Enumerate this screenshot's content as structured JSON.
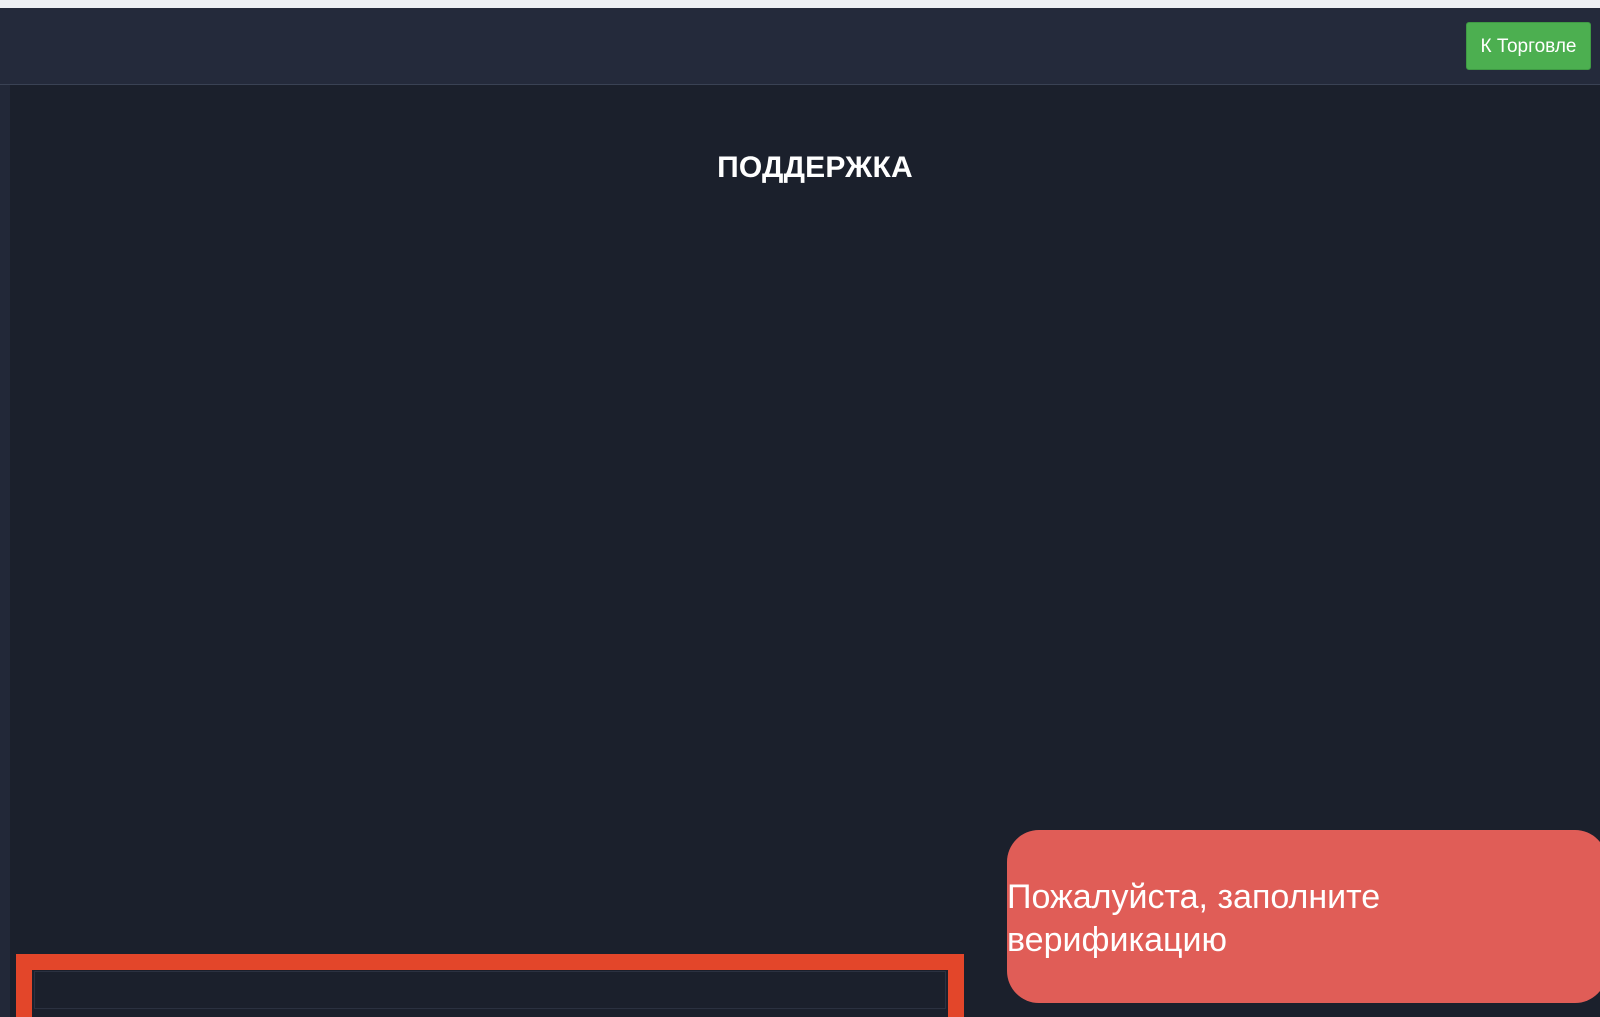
{
  "header": {
    "trade_button_label": "К Торговле"
  },
  "main": {
    "title": "ПОДДЕРЖКА",
    "message_input": {
      "value": "",
      "placeholder": ""
    }
  },
  "toast": {
    "message": "Пожалуйста, заполните верификацию"
  },
  "colors": {
    "background": "#1b202c",
    "header": "#242a3b",
    "accent_green": "#4caf50",
    "highlight_red": "#e3462a",
    "toast_red": "#e05d57"
  }
}
